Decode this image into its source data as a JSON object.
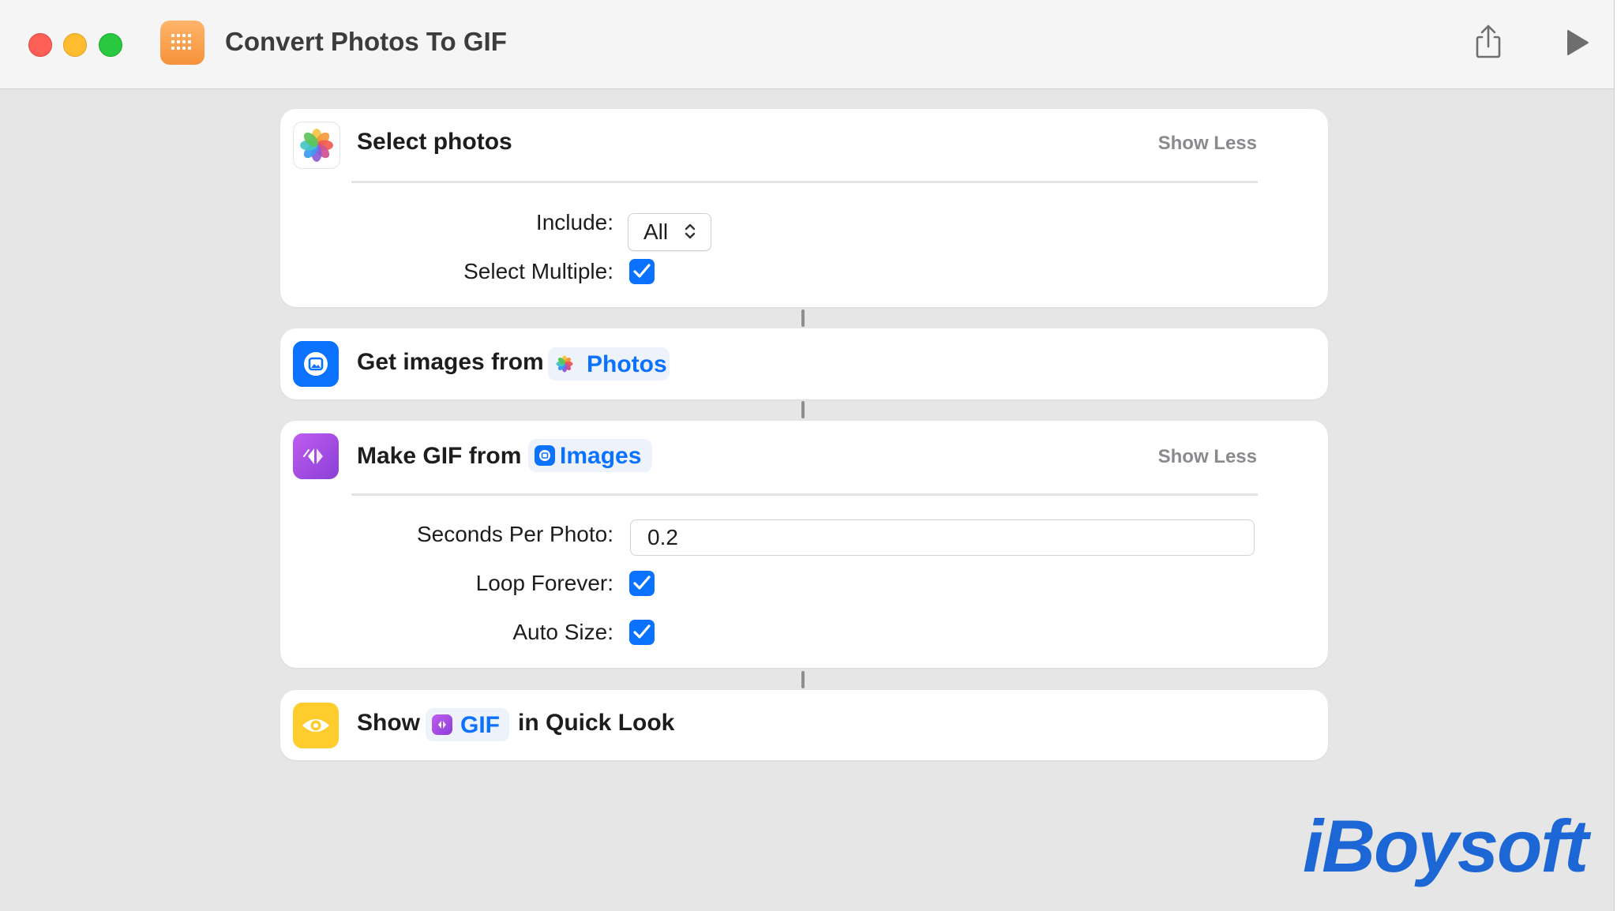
{
  "window": {
    "title": "Convert Photos To GIF"
  },
  "actions": {
    "select_photos": {
      "title": "Select photos",
      "show_less": "Show Less",
      "include_label": "Include:",
      "include_value": "All",
      "select_multiple_label": "Select Multiple:",
      "select_multiple_checked": true
    },
    "get_images": {
      "title": "Get images from",
      "source_token": "Photos"
    },
    "make_gif": {
      "title": "Make GIF from",
      "input_token": "Images",
      "show_less": "Show Less",
      "seconds_label": "Seconds Per Photo:",
      "seconds_value": "0.2",
      "loop_label": "Loop Forever:",
      "loop_checked": true,
      "autosize_label": "Auto Size:",
      "autosize_checked": true
    },
    "show_quick_look": {
      "prefix": "Show",
      "token": "GIF",
      "suffix": "in Quick Look"
    }
  },
  "watermark": "iBoysoft",
  "colors": {
    "accent": "#0a72ff",
    "token_bg": "#edf2fb",
    "photos_gradient": [
      "#f7c443",
      "#ef5b52",
      "#8f5bd8",
      "#3b9af2",
      "#5cc45a"
    ],
    "images_icon": "#0a72ff",
    "gif_icon": "#a44ee0",
    "quicklook_icon": "#ffcc2e",
    "app_icon": "#f7923b"
  },
  "icons": {
    "app": "shortcuts-grid-icon",
    "share": "share-icon",
    "run": "play-icon",
    "select_photos": "photos-icon",
    "get_images": "image-icon",
    "make_gif": "gif-icon",
    "show": "eye-icon"
  }
}
